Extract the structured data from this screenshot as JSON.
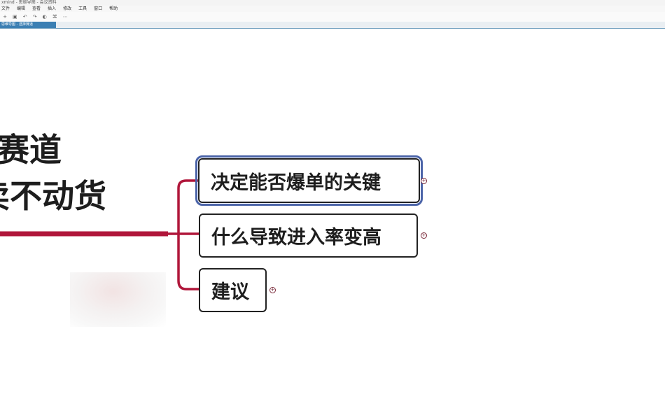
{
  "titlebar": {
    "text": "xmind - 思维导图 - 会议资料"
  },
  "menu": {
    "items": [
      "文件",
      "编辑",
      "查看",
      "插入",
      "修改",
      "工具",
      "窗口",
      "帮助"
    ]
  },
  "toolbar": {
    "items": [
      "+",
      "▣",
      "↶",
      "↷",
      "◐",
      "⌘",
      "⋯"
    ]
  },
  "tab": {
    "label": "思维导图 - 选择赛道"
  },
  "mindmap": {
    "central": {
      "line1": "赛道",
      "line2": "卖不动货"
    },
    "topics": [
      {
        "label": "决定能否爆单的关键"
      },
      {
        "label": "什么导致进入率变高"
      },
      {
        "label": "建议"
      }
    ]
  },
  "colors": {
    "branch": "#b0163a",
    "selection": "#4a63a8"
  }
}
